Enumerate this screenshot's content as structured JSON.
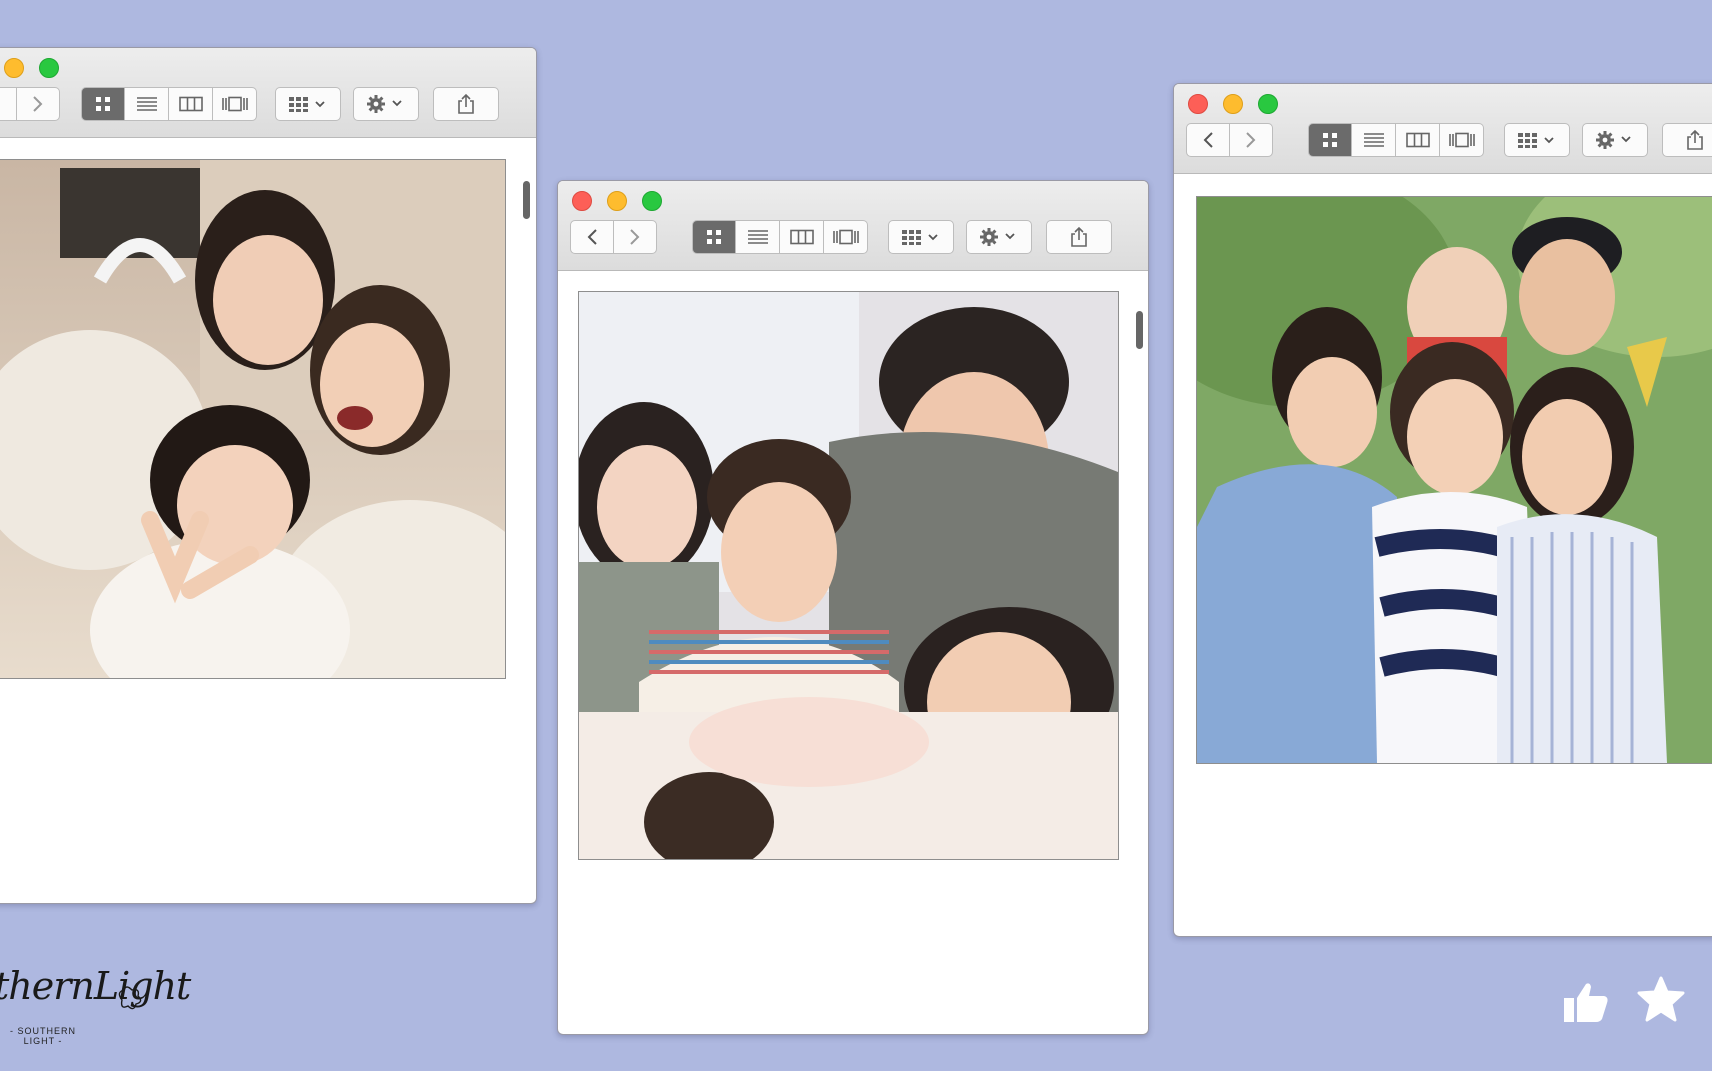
{
  "background_color": "#aeb8e0",
  "windows": [
    {
      "id": "left",
      "photo_description_icon": "group-photo-icon"
    },
    {
      "id": "middle",
      "photo_description_icon": "group-photo-icon"
    },
    {
      "id": "right",
      "photo_description_icon": "group-photo-icon"
    }
  ],
  "toolbar_icons": [
    "back-icon",
    "forward-icon",
    "icon-view-icon",
    "list-view-icon",
    "column-view-icon",
    "gallery-view-icon",
    "arrange-icon",
    "gear-icon",
    "share-icon"
  ],
  "watermark": {
    "script": "thernLight",
    "sub_line1": "- SOUTHERN",
    "sub_line2": "LIGHT -"
  },
  "reactions": {
    "like_icon": "thumbs-up-icon",
    "favorite_icon": "star-icon",
    "icon_color": "#ffffff"
  }
}
